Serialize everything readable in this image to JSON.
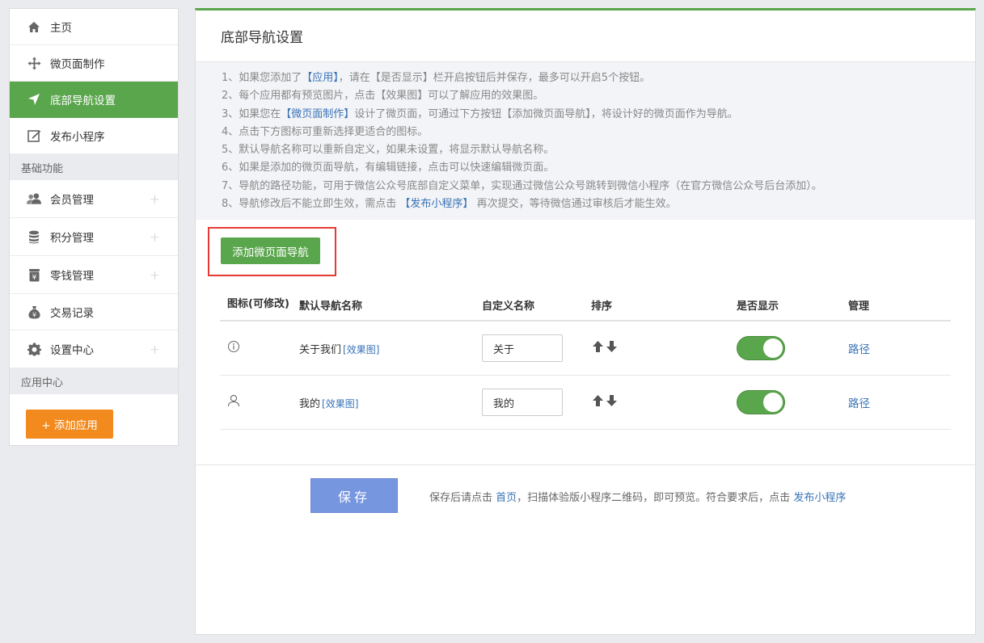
{
  "sidebar": {
    "items_top": [
      {
        "label": "主页",
        "icon": "home-icon"
      },
      {
        "label": "微页面制作",
        "icon": "move-icon"
      },
      {
        "label": "底部导航设置",
        "icon": "navigation-arrow-icon"
      },
      {
        "label": "发布小程序",
        "icon": "edit-icon"
      }
    ],
    "section_basic": "基础功能",
    "items_basic": [
      {
        "label": "会员管理",
        "icon": "users-icon"
      },
      {
        "label": "积分管理",
        "icon": "database-icon"
      },
      {
        "label": "零钱管理",
        "icon": "yen-jar-icon"
      },
      {
        "label": "交易记录",
        "icon": "money-bag-icon"
      },
      {
        "label": "设置中心",
        "icon": "gear-icon"
      }
    ],
    "section_apps": "应用中心",
    "add_app_label": "+ 添加应用"
  },
  "main": {
    "title": "底部导航设置",
    "notes": {
      "n1_a": "1、如果您添加了",
      "n1_hl": "【应用】",
      "n1_b": "，请在【是否显示】栏开启按钮后并保存，最多可以开启5个按钮。",
      "n2": "2、每个应用都有预览图片，点击【效果图】可以了解应用的效果图。",
      "n3_a": "3、如果您在",
      "n3_hl": "【微页面制作】",
      "n3_b": "设计了微页面，可通过下方按钮【添加微页面导航】，将设计好的微页面作为导航。",
      "n4": "4、点击下方图标可重新选择更适合的图标。",
      "n5": "5、默认导航名称可以重新自定义，如果未设置，将显示默认导航名称。",
      "n6": "6、如果是添加的微页面导航，有编辑链接，点击可以快速编辑微页面。",
      "n7": "7、导航的路径功能，可用于微信公众号底部自定义菜单，实现通过微信公众号跳转到微信小程序（在官方微信公众号后台添加）。",
      "n8_a": "8、导航修改后不能立即生效，需点击",
      "n8_hl": "【发布小程序】",
      "n8_b": "再次提交，等待微信通过审核后才能生效。"
    },
    "add_nav_label": "添加微页面导航",
    "table": {
      "headers": {
        "icon": "图标(可修改)",
        "default_name": "默认导航名称",
        "custom_name": "自定义名称",
        "sort": "排序",
        "show": "是否显示",
        "manage": "管理"
      },
      "rows": [
        {
          "icon": "info-circle-icon",
          "name": "关于我们",
          "effect": "[效果图]",
          "custom": "关于",
          "show": true,
          "manage": "路径"
        },
        {
          "icon": "user-icon",
          "name": "我的",
          "effect": "[效果图]",
          "custom": "我的",
          "show": true,
          "manage": "路径"
        }
      ]
    },
    "footer": {
      "save_label": "保存",
      "tip_a": "保存后请点击",
      "tip_link1": "首页",
      "tip_b": "，扫描体验版小程序二维码，即可预览。符合要求后，点击",
      "tip_link2": "发布小程序"
    }
  },
  "colors": {
    "accent": "#5aa64c",
    "orange": "#f38a1d",
    "link": "#3a73b7",
    "save": "#7696e0",
    "highlight_box": "#e53935"
  }
}
